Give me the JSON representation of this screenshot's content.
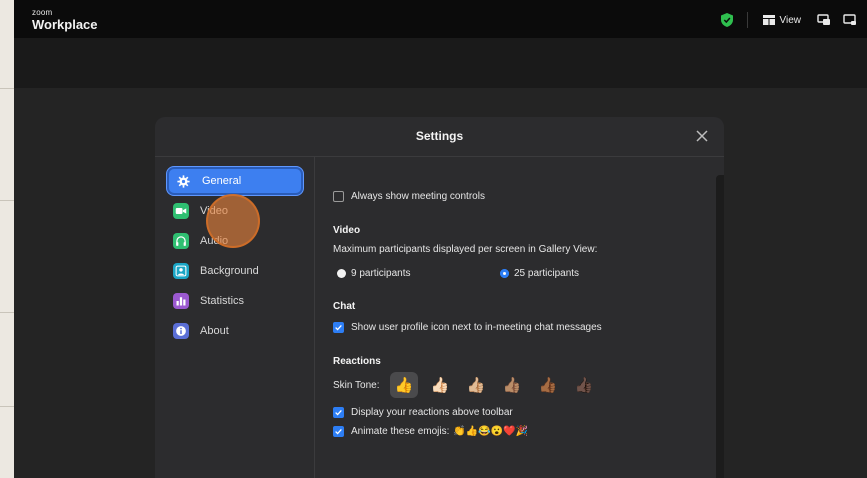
{
  "app": {
    "logo_small": "zoom",
    "logo_big": "Workplace",
    "view_label": "View"
  },
  "settings": {
    "title": "Settings",
    "nav": [
      {
        "label": "General",
        "icon": "gear-icon",
        "color": "#3d7ff0"
      },
      {
        "label": "Video",
        "icon": "video-camera-icon",
        "color": "#2fbf71"
      },
      {
        "label": "Audio",
        "icon": "headphones-icon",
        "color": "#2fbf71"
      },
      {
        "label": "Background",
        "icon": "person-icon",
        "color": "#1ba6c6"
      },
      {
        "label": "Statistics",
        "icon": "bar-chart-icon",
        "color": "#9b59d0"
      },
      {
        "label": "About",
        "icon": "info-icon",
        "color": "#5b6fd6"
      }
    ],
    "general": {
      "always_show_controls": "Always show meeting controls",
      "video_title": "Video",
      "gallery_label": "Maximum participants displayed per screen in Gallery View:",
      "option_9": "9 participants",
      "option_25": "25 participants",
      "selected": "25 participants",
      "chat_title": "Chat",
      "chat_profile_icon": "Show user profile icon next to in-meeting chat messages",
      "reactions_title": "Reactions",
      "skin_tone_label": "Skin Tone:",
      "skin_tones": [
        "👍",
        "👍🏻",
        "👍🏼",
        "👍🏽",
        "👍🏾",
        "👍🏿"
      ],
      "display_reactions": "Display your reactions above toolbar",
      "animate_emojis": "Animate these emojis:",
      "animated_emoji_list": "👏👍😂😮❤️🎉"
    }
  },
  "colors": {
    "accent": "#3d7ff0",
    "checkbox": "#2d7ef5",
    "shield": "#2fbf4f"
  }
}
